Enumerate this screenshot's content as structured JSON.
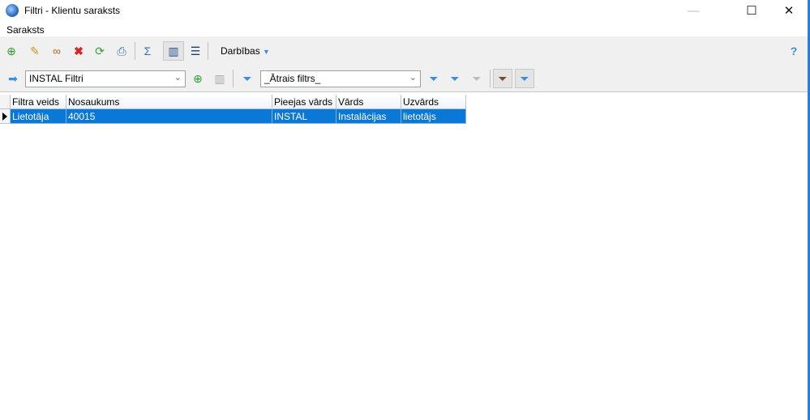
{
  "window": {
    "title": "Filtri - Klientu saraksts",
    "minimize": "—",
    "maximize": "☐",
    "close": "✕"
  },
  "menu": {
    "items": [
      "Saraksts"
    ]
  },
  "toolbar1": {
    "actions_label": "Darbības",
    "help": "?"
  },
  "toolbar2": {
    "filter_set": "INSTAL Filtri",
    "quick_filter": "_Ātrais filtrs_"
  },
  "grid": {
    "columns": [
      "Filtra veids",
      "Nosaukums",
      "Pieejas vārds",
      "Vārds",
      "Uzvārds"
    ],
    "rows": [
      [
        "Lietotāja",
        "40015",
        "INSTAL",
        "Instalācijas",
        "lietotājs"
      ]
    ]
  },
  "colors": {
    "selection": "#0a78d7",
    "toolbar_bg": "#f0f0f0"
  }
}
